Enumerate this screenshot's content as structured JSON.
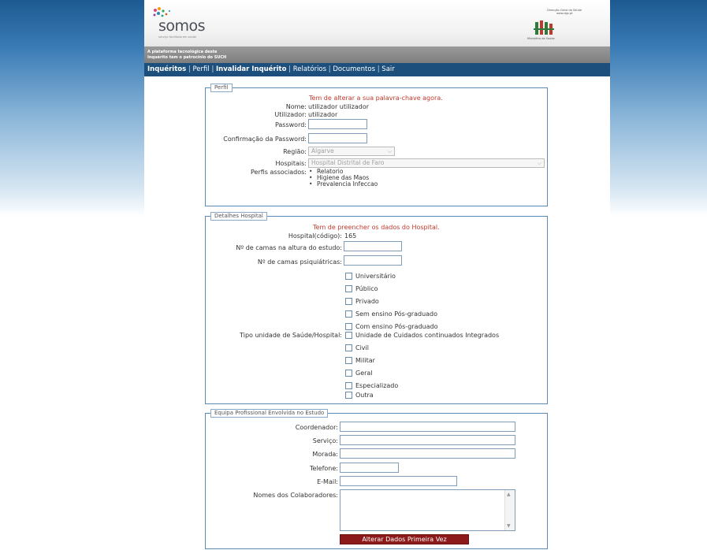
{
  "header": {
    "logo_text": "somos",
    "logo_tagline": "serviço facilitado em saúde",
    "dgs_name": "Direcção-Geral da Saúde",
    "dgs_url": "www.dgs.pt",
    "ministry": "Ministério da Saúde"
  },
  "sponsor": {
    "line1": "A plataforma tecnológica deste",
    "line2": "Inquérito tem o patrocínio do SUCH"
  },
  "nav": {
    "items": [
      "Inquéritos",
      "Perfil",
      "Invalidar Inquérito",
      "Relatórios",
      "Documentos",
      "Sair"
    ],
    "separator": "|"
  },
  "perfil": {
    "legend": "Perfil",
    "warning": "Tem de alterar a sua palavra-chave agora.",
    "nome_label": "Nome:",
    "nome_value": "utilizador utilizador",
    "utilizador_label": "Utilizador:",
    "utilizador_value": "utilizador",
    "password_label": "Password:",
    "confirm_label": "Confirmação da Password:",
    "regiao_label": "Região:",
    "regiao_value": "Algarve",
    "hospitais_label": "Hospitais:",
    "hospitais_value": "Hospital Distrital de Faro",
    "perfis_label": "Perfis associados:",
    "perfis": [
      "Relatorio",
      "Higiene das Maos",
      "Prevalencia Infeccao"
    ]
  },
  "hospital": {
    "legend": "Detalhes Hospital",
    "warning": "Tem de preencher os dados do Hospital.",
    "codigo_label": "Hospital(código):",
    "codigo_value": "165",
    "camas_label": "Nº de camas na altura do estudo:",
    "camas_psiq_label": "Nº de camas psiquiátricas:",
    "tipo_label": "Tipo unidade de Saúde/Hospital:",
    "tipos": [
      "Universitário",
      "Público",
      "Privado",
      "Sem ensino Pós-graduado",
      "Com ensino Pós-graduado",
      "Unidade de Cuidados continuados Integrados",
      "Civil",
      "Militar",
      "Geral",
      "Especializado",
      "Outra"
    ]
  },
  "equipa": {
    "legend": "Equipa Profissional Envolvida no Estudo",
    "coordenador_label": "Coordenador:",
    "servico_label": "Serviço:",
    "morada_label": "Morada:",
    "telefone_label": "Telefone:",
    "email_label": "E-Mail:",
    "colaboradores_label": "Nomes dos Colaboradores:",
    "submit_label": "Alterar Dados Primeira Vez"
  },
  "colors": {
    "nav_bg": "#1c4f7c",
    "warning": "#c0392b",
    "button": "#8c1a1a",
    "border": "#5b8ab4"
  }
}
